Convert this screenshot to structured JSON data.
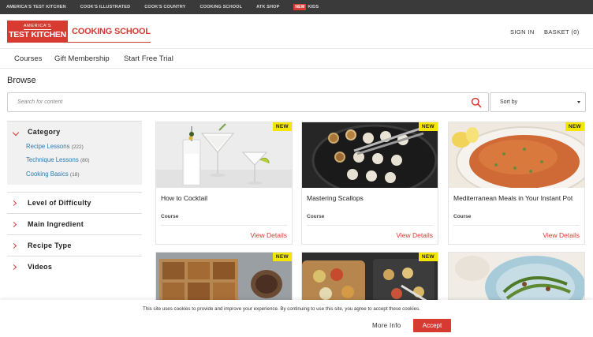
{
  "topbar": {
    "links": [
      "AMERICA'S TEST KITCHEN",
      "COOK'S ILLUSTRATED",
      "COOK'S COUNTRY",
      "COOKING SCHOOL",
      "ATK SHOP"
    ],
    "kids_badge": "NEW",
    "kids_label": "KIDS"
  },
  "header": {
    "logo_line1": "AMERICA'S",
    "logo_line2": "TEST KITCHEN",
    "logo_school": "COOKING SCHOOL",
    "signin": "SIGN IN",
    "basket": "BASKET (0)"
  },
  "nav": {
    "courses": "Courses",
    "gift": "Gift Membership",
    "trial": "Start Free Trial"
  },
  "browse": {
    "title": "Browse",
    "search_placeholder": "Search for content",
    "sort_label": "Sort by"
  },
  "facets": {
    "category": {
      "label": "Category",
      "items": [
        {
          "label": "Recipe Lessons",
          "count": "(222)"
        },
        {
          "label": "Technique Lessons",
          "count": "(80)"
        },
        {
          "label": "Cooking Basics",
          "count": "(18)"
        }
      ]
    },
    "difficulty": "Level of Difficulty",
    "ingredient": "Main Ingredient",
    "recipe_type": "Recipe Type",
    "videos": "Videos"
  },
  "cards": [
    {
      "title": "How to Cocktail",
      "type": "Course",
      "badge": "NEW",
      "cta": "View Details"
    },
    {
      "title": "Mastering Scallops",
      "type": "Course",
      "badge": "NEW",
      "cta": "View Details"
    },
    {
      "title": "Mediterranean Meals in Your Instant Pot",
      "type": "Course",
      "badge": "NEW",
      "cta": "View Details"
    },
    {
      "badge": "NEW"
    },
    {
      "badge": "NEW"
    },
    {}
  ],
  "cookie": {
    "text": "This site uses cookies to provide and improve your experience. By continuing to use this site, you agree to accept these cookies.",
    "more_info": "More Info",
    "accept": "Accept"
  },
  "colors": {
    "brand_red": "#d73a31",
    "link_blue": "#2a7ab0",
    "badge_yellow": "#f5e600",
    "topbar_bg": "#3a3a3a"
  }
}
